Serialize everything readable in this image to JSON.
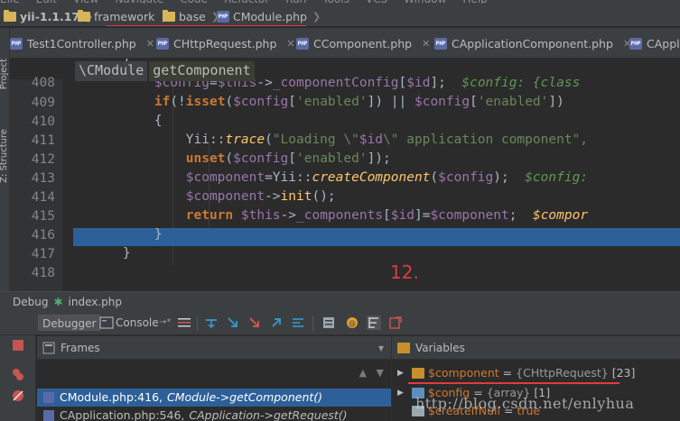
{
  "navbar": {
    "project": "yii-1.1.17",
    "crumbs": [
      "framework",
      "base",
      "CModule.php"
    ]
  },
  "left_strip": [
    "Project",
    "Z: Structure"
  ],
  "tabs": [
    {
      "label": "Test1Controller.php"
    },
    {
      "label": "CHttpRequest.php"
    },
    {
      "label": "CComponent.php"
    },
    {
      "label": "CApplicationComponent.php"
    },
    {
      "label": "CAppli"
    }
  ],
  "editor": {
    "breadcrumb": [
      "\\CModule",
      "getComponent"
    ],
    "line_numbers": [
      "408",
      "409",
      "410",
      "411",
      "412",
      "413",
      "414",
      "415",
      "416",
      "417",
      "418"
    ],
    "current_line": "416"
  },
  "annotation": "12.",
  "debug": {
    "label": "Debug",
    "config": "index.php",
    "tab_debugger": "Debugger",
    "tab_console": "Console"
  },
  "frames": {
    "title": "Frames",
    "items": [
      {
        "file": "CModule.php:416,",
        "method": "CModule->getComponent()"
      },
      {
        "file": "CApplication.php:546,",
        "method": "CApplication->getRequest()"
      }
    ]
  },
  "variables": {
    "title": "Variables",
    "items": [
      {
        "name": "$component",
        "eq": "=",
        "type": "{CHttpRequest}",
        "count": "[23]"
      },
      {
        "name": "$config",
        "eq": "=",
        "type": "{array}",
        "count": "[1]"
      },
      {
        "name": "$createIfNull",
        "eq": "=",
        "type": "true",
        "count": ""
      }
    ]
  },
  "watermark": "http://blog.csdn.net/enlyhua",
  "colors": {
    "accent_red": "#e03c3c",
    "selection": "#2d6099",
    "keyword": "#cc7832",
    "variable": "#9876aa",
    "string": "#6a8759",
    "comment": "#629755"
  }
}
